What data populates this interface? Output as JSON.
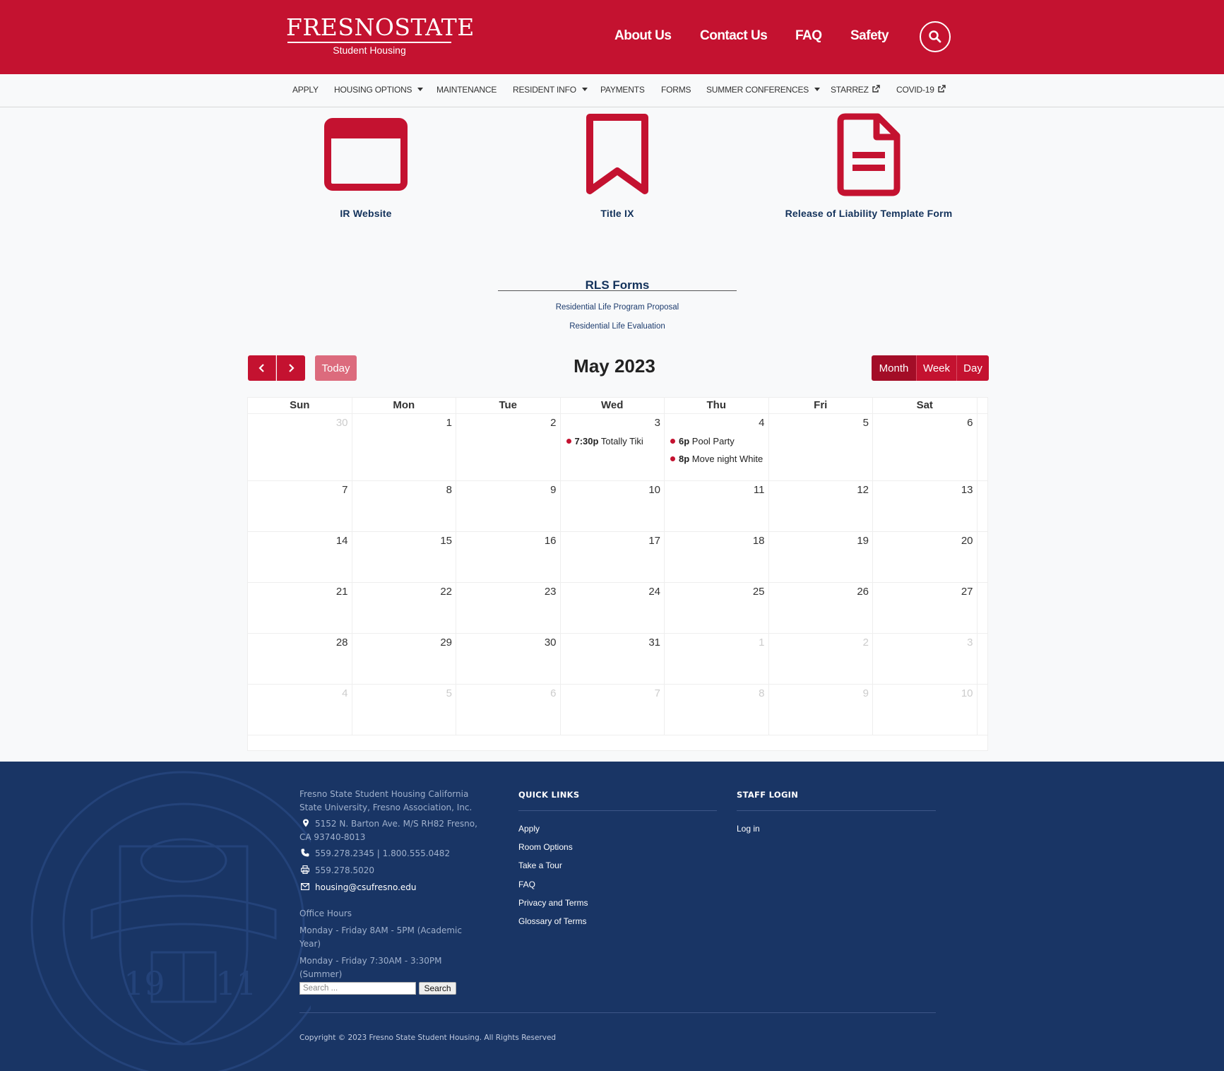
{
  "brand": {
    "name": "FRESNOSTATE",
    "sub": "Student Housing",
    "color": "#c41230"
  },
  "main_nav": [
    "About Us",
    "Contact Us",
    "FAQ",
    "Safety"
  ],
  "sub_nav": [
    "APPLY",
    "HOUSING OPTIONS",
    "MAINTENANCE",
    "RESIDENT INFO",
    "PAYMENTS",
    "FORMS",
    "SUMMER CONFERENCES",
    "STARREZ",
    "COVID-19"
  ],
  "cards": [
    "IR Website",
    "Title IX",
    "Release of Liability Template Form"
  ],
  "rls": {
    "title": "RLS Forms",
    "links": [
      "Residential Life Program Proposal",
      "Residential Life Evaluation"
    ]
  },
  "calendar": {
    "title": "May 2023",
    "today": "Today",
    "views": [
      "Month",
      "Week",
      "Day"
    ],
    "active_view": "Month",
    "days": [
      "Sun",
      "Mon",
      "Tue",
      "Wed",
      "Thu",
      "Fri",
      "Sat"
    ],
    "weeks": [
      [
        "30",
        "1",
        "2",
        "3",
        "4",
        "5",
        "6"
      ],
      [
        "7",
        "8",
        "9",
        "10",
        "11",
        "12",
        "13"
      ],
      [
        "14",
        "15",
        "16",
        "17",
        "18",
        "19",
        "20"
      ],
      [
        "21",
        "22",
        "23",
        "24",
        "25",
        "26",
        "27"
      ],
      [
        "28",
        "29",
        "30",
        "31",
        "1",
        "2",
        "3"
      ],
      [
        "4",
        "5",
        "6",
        "7",
        "8",
        "9",
        "10"
      ]
    ],
    "events": [
      {
        "time": "7:30p",
        "title": "Totally Tiki"
      },
      {
        "time": "6p",
        "title": "Pool Party"
      },
      {
        "time": "8p",
        "title": "Move night White ("
      }
    ]
  },
  "footer": {
    "org": "Fresno State Student Housing California State University, Fresno Association, Inc.",
    "address": "5152 N. Barton Ave. M/S RH82 Fresno, CA 93740-8013",
    "phone": "559.278.2345 | 1.800.555.0482",
    "fax": "559.278.5020",
    "email": "housing@csufresno.edu",
    "hours_label": "Office Hours",
    "hours": [
      "Monday - Friday 8AM - 5PM (Academic Year)",
      "Monday - Friday 7:30AM - 3:30PM (Summer)"
    ],
    "search_placeholder": "Search ...",
    "search_button": "Search",
    "quick_links_title": "QUICK LINKS",
    "quick_links": [
      "Apply",
      "Room Options",
      "Take a Tour",
      "FAQ",
      "Privacy and Terms",
      "Glossary of Terms"
    ],
    "staff_title": "STAFF LOGIN",
    "staff_link": "Log in",
    "copyright": "Copyright © 2023 Fresno State Student Housing. All Rights Reserved"
  }
}
